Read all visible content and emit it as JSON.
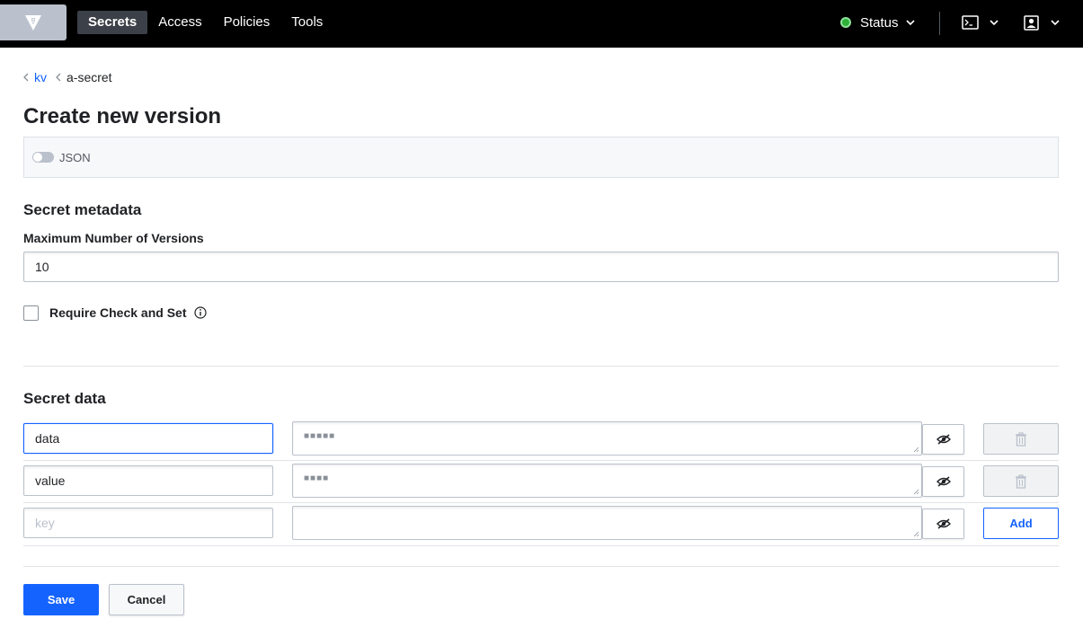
{
  "nav": {
    "logo_icon": "vault-logo-icon",
    "links": [
      {
        "label": "Secrets",
        "active": true
      },
      {
        "label": "Access",
        "active": false
      },
      {
        "label": "Policies",
        "active": false
      },
      {
        "label": "Tools",
        "active": false
      }
    ],
    "status_label": "Status",
    "status_color": "#2eb039",
    "console_icon": "terminal-icon",
    "user_icon": "user-icon"
  },
  "breadcrumb": {
    "items": [
      {
        "label": "kv"
      }
    ],
    "current": "a-secret"
  },
  "page_title": "Create new version",
  "json_toggle": {
    "label": "JSON",
    "on": false
  },
  "metadata": {
    "title": "Secret metadata",
    "max_versions_label": "Maximum Number of Versions",
    "max_versions_value": "10",
    "cas_label": "Require Check and Set",
    "cas_checked": false
  },
  "secret_data": {
    "title": "Secret data",
    "rows": [
      {
        "key": "data",
        "masked_value": "■■■■■",
        "action": "delete"
      },
      {
        "key": "value",
        "masked_value": "■■■■",
        "action": "delete"
      },
      {
        "key": "",
        "key_placeholder": "key",
        "masked_value": "",
        "action_label": "Add"
      }
    ]
  },
  "footer": {
    "save_label": "Save",
    "cancel_label": "Cancel"
  },
  "colors": {
    "accent": "#1563ff",
    "nav_bg": "#000000"
  }
}
